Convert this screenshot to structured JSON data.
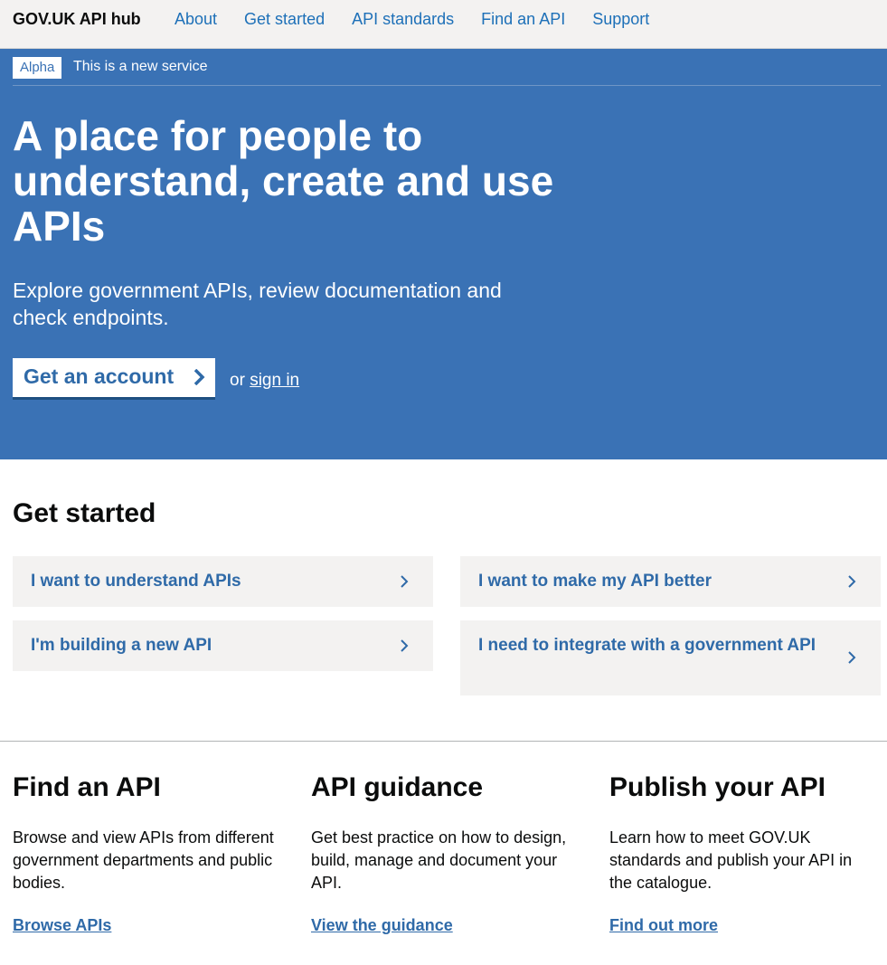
{
  "header": {
    "brand": "GOV.UK API hub",
    "nav": [
      "About",
      "Get started",
      "API standards",
      "Find an API",
      "Support"
    ]
  },
  "phase_banner": {
    "tag": "Alpha",
    "text": "This is a new service"
  },
  "hero": {
    "title": "A place for people to understand, create and use APIs",
    "subtitle": "Explore government APIs, review documentation and check endpoints.",
    "cta_label": "Get an account",
    "or_text": "or",
    "signin_label": "sign in"
  },
  "get_started": {
    "title": "Get started",
    "cards": [
      "I want to understand APIs",
      "I want to make my API better",
      "I'm building a new API",
      "I need to integrate with a government API"
    ]
  },
  "columns": [
    {
      "title": "Find an API",
      "text": "Browse and view APIs from different government departments and public bodies.",
      "link": "Browse APIs"
    },
    {
      "title": "API guidance",
      "text": "Get best practice on how to design, build, manage and document your API.",
      "link": "View the guidance"
    },
    {
      "title": "Publish your API",
      "text": "Learn how to meet GOV.UK standards and publish your API in the catalogue.",
      "link": "Find out more"
    }
  ],
  "colors": {
    "hero_bg": "#3a72b5",
    "link": "#2f6aa8",
    "card_bg": "#f3f2f1",
    "header_bg": "#f3f2f1"
  },
  "icons": {
    "cta": "chevron-right-icon",
    "card": "chevron-right-icon"
  }
}
